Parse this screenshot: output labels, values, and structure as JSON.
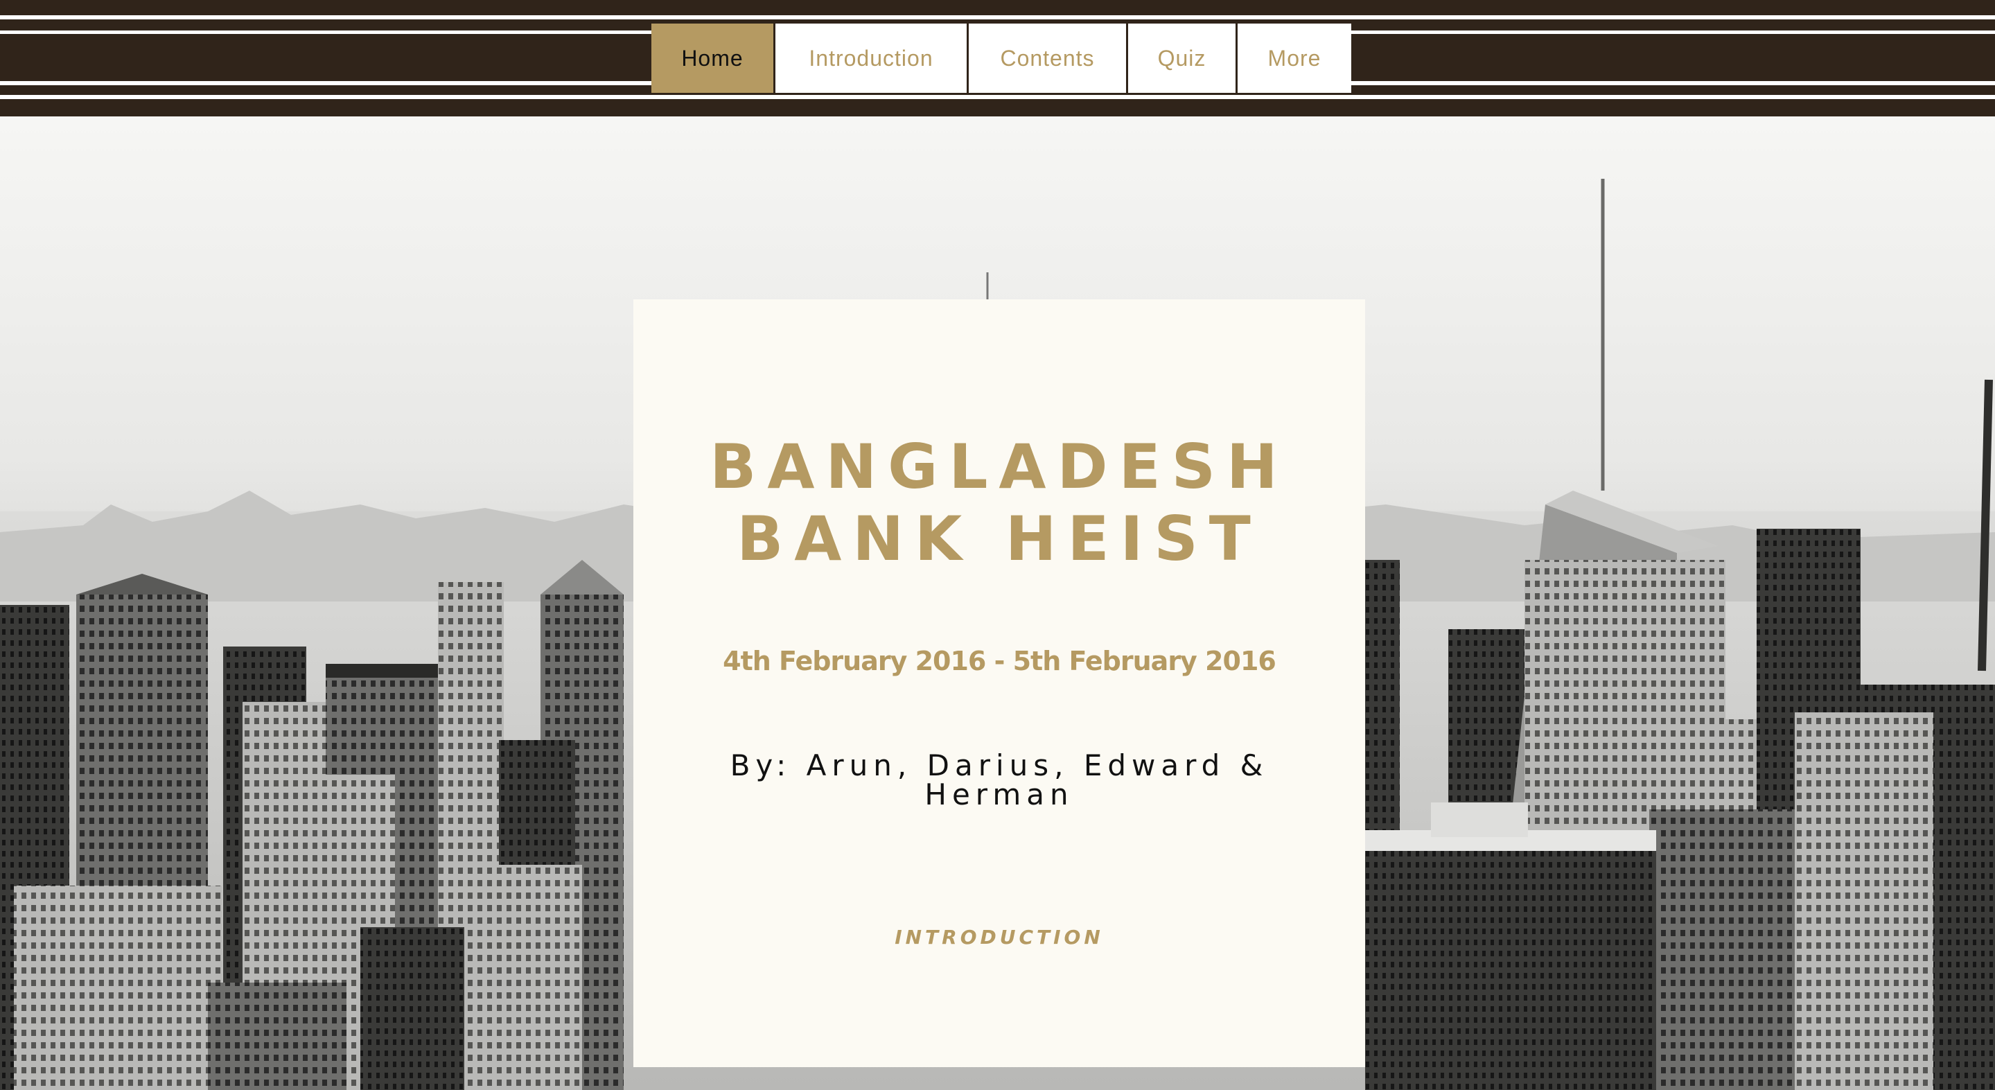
{
  "nav": {
    "items": [
      {
        "label": "Home",
        "active": true
      },
      {
        "label": "Introduction",
        "active": false
      },
      {
        "label": "Contents",
        "active": false
      },
      {
        "label": "Quiz",
        "active": false
      },
      {
        "label": "More",
        "active": false
      }
    ]
  },
  "card": {
    "title_line1": "BANGLADESH",
    "title_line2": "BANK HEIST",
    "dates": "4th February 2016 - 5th February 2016",
    "authors": "By: Arun, Darius, Edward & Herman",
    "link": "INTRODUCTION"
  },
  "colors": {
    "header_bg": "#30241a",
    "accent_gold": "#b59a62",
    "card_bg": "#fcfaf3"
  },
  "hero": {
    "image": "black-and-white city skyline"
  }
}
